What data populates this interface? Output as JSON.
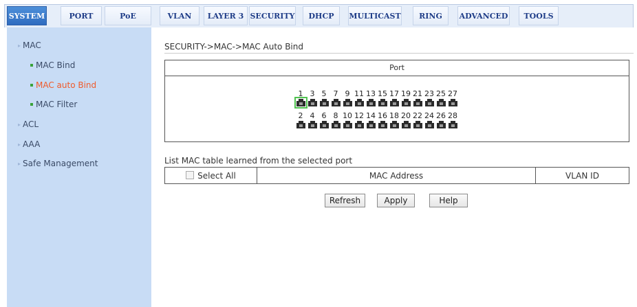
{
  "tabs": [
    {
      "label": "SYSTEM",
      "active": true
    },
    {
      "label": "PORT",
      "active": false
    },
    {
      "label": "PoE",
      "active": false
    },
    {
      "label": "VLAN",
      "active": false
    },
    {
      "label": "LAYER 3",
      "active": false
    },
    {
      "label": "SECURITY",
      "active": false
    },
    {
      "label": "DHCP",
      "active": false
    },
    {
      "label": "MULTICAST",
      "active": false
    },
    {
      "label": "RING",
      "active": false
    },
    {
      "label": "ADVANCED",
      "active": false
    },
    {
      "label": "TOOLS",
      "active": false
    }
  ],
  "sidebar": {
    "items": [
      {
        "label": "MAC",
        "type": "group"
      },
      {
        "label": "MAC Bind",
        "type": "sub"
      },
      {
        "label": "MAC auto Bind",
        "type": "sub",
        "active": true
      },
      {
        "label": "MAC Filter",
        "type": "sub"
      },
      {
        "label": "ACL",
        "type": "group"
      },
      {
        "label": "AAA",
        "type": "group"
      },
      {
        "label": "Safe Management",
        "type": "group"
      }
    ]
  },
  "breadcrumb": "SECURITY->MAC->MAC Auto Bind",
  "port_panel": {
    "header": "Port",
    "odd_ports": [
      "1",
      "3",
      "5",
      "7",
      "9",
      "11",
      "13",
      "15",
      "17",
      "19",
      "21",
      "23",
      "25",
      "27"
    ],
    "even_ports": [
      "2",
      "4",
      "6",
      "8",
      "10",
      "12",
      "14",
      "16",
      "18",
      "20",
      "22",
      "24",
      "26",
      "28"
    ],
    "selected_port": "1"
  },
  "mac_list": {
    "label": "List MAC table learned from the selected port",
    "select_all_label": "Select All",
    "columns": [
      "MAC Address",
      "VLAN ID"
    ]
  },
  "buttons": {
    "refresh": "Refresh",
    "apply": "Apply",
    "help": "Help"
  },
  "colors": {
    "active_tab": "#2f6cc0",
    "sidebar_bg": "#c8dcf5",
    "active_nav": "#f05a2a",
    "selected_port_border": "#4fc24f"
  }
}
